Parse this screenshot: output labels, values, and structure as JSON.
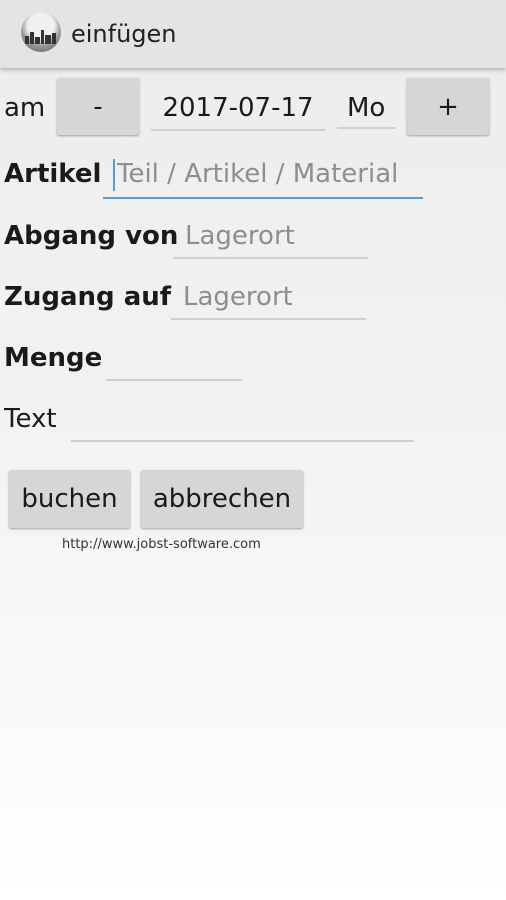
{
  "actionbar": {
    "title": "einfügen",
    "icon": "app-logo-icon"
  },
  "date_row": {
    "label": "am",
    "prev_button": "-",
    "date_value": "2017-07-17",
    "weekday_value": "Mo",
    "next_button": "+"
  },
  "artikel": {
    "label": "Artikel",
    "placeholder": "Teil / Artikel / Material"
  },
  "abgang": {
    "label": "Abgang von",
    "placeholder": "Lagerort"
  },
  "zugang": {
    "label": "Zugang auf",
    "placeholder": "Lagerort"
  },
  "menge": {
    "label": "Menge",
    "value": ""
  },
  "text": {
    "label": "Text",
    "value": ""
  },
  "actions": {
    "book_label": "buchen",
    "cancel_label": "abbrechen"
  },
  "footer": {
    "link": "http://www.jobst-software.com"
  },
  "colors": {
    "accent": "#5a9bd4",
    "button_bg": "#d6d6d6",
    "actionbar_bg": "#e4e4e4"
  }
}
